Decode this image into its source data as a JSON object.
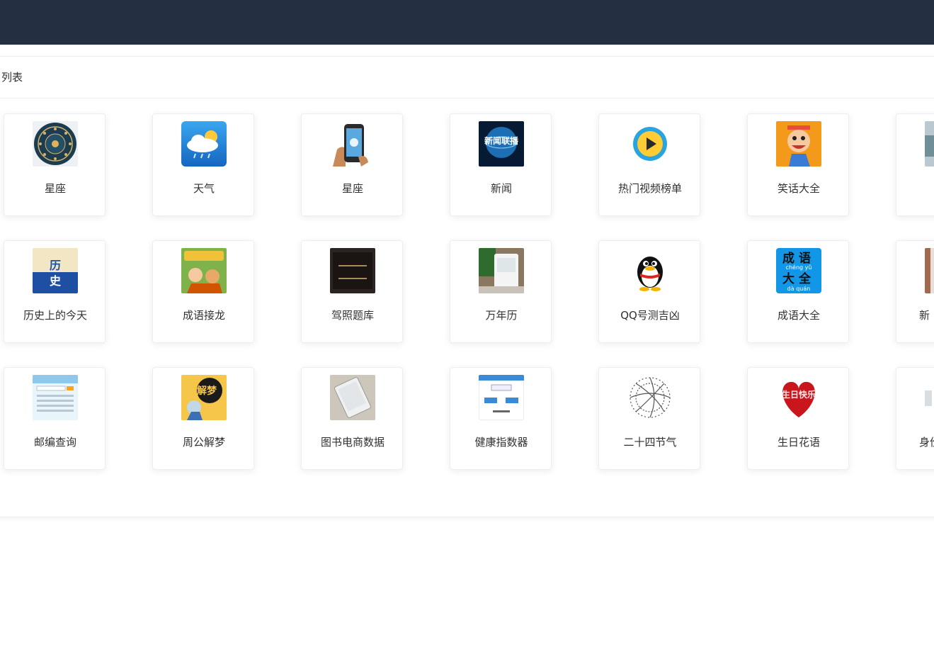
{
  "panel": {
    "title": "列表"
  },
  "tiles": [
    {
      "label": "星座",
      "icon": "zodiac-icon"
    },
    {
      "label": "天气",
      "icon": "weather-icon"
    },
    {
      "label": "星座",
      "icon": "phone-icon"
    },
    {
      "label": "新闻",
      "icon": "news-icon"
    },
    {
      "label": "热门视频榜单",
      "icon": "video-play-icon"
    },
    {
      "label": "笑话大全",
      "icon": "jokes-icon"
    },
    {
      "label": "",
      "icon": "partial-icon"
    },
    {
      "label": "历史上的今天",
      "icon": "history-book-icon"
    },
    {
      "label": "成语接龙",
      "icon": "idiom-book-icon"
    },
    {
      "label": "驾照题库",
      "icon": "license-icon"
    },
    {
      "label": "万年历",
      "icon": "calendar-device-icon"
    },
    {
      "label": "QQ号测吉凶",
      "icon": "qq-penguin-icon"
    },
    {
      "label": "成语大全",
      "icon": "idiom-dictionary-icon"
    },
    {
      "label": "新",
      "icon": "partial-icon"
    },
    {
      "label": "邮编查询",
      "icon": "postcode-icon"
    },
    {
      "label": "周公解梦",
      "icon": "dream-icon"
    },
    {
      "label": "图书电商数据",
      "icon": "ebook-reader-icon"
    },
    {
      "label": "健康指数器",
      "icon": "health-calculator-icon"
    },
    {
      "label": "二十四节气",
      "icon": "solar-terms-icon"
    },
    {
      "label": "生日花语",
      "icon": "birthday-flower-icon"
    },
    {
      "label": "身份",
      "icon": "partial-icon"
    }
  ],
  "icon_text": {
    "news": "新闻联播",
    "idiom_top": "成语",
    "idiom_bottom": "大全",
    "idiom_pinyin_1": "chéng yǔ",
    "idiom_pinyin_2": "dà quán",
    "history_1": "历",
    "history_2": "史",
    "dream": "解梦",
    "birthday": "生日快乐"
  },
  "colors": {
    "topbar": "#242f42",
    "text": "#303133",
    "border": "#ebeef5"
  }
}
